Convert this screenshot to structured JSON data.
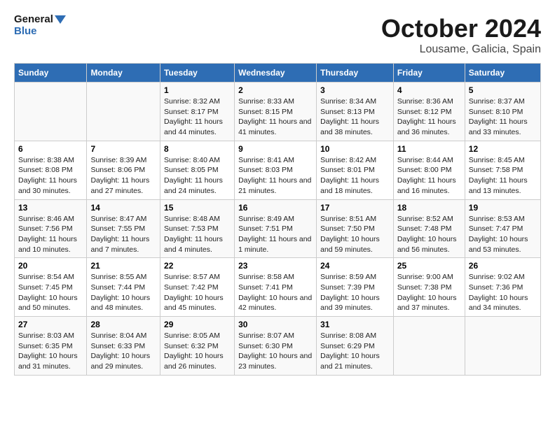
{
  "header": {
    "logo_general": "General",
    "logo_blue": "Blue",
    "title": "October 2024",
    "subtitle": "Lousame, Galicia, Spain"
  },
  "columns": [
    "Sunday",
    "Monday",
    "Tuesday",
    "Wednesday",
    "Thursday",
    "Friday",
    "Saturday"
  ],
  "weeks": [
    [
      {
        "day": "",
        "sunrise": "",
        "sunset": "",
        "daylight": ""
      },
      {
        "day": "",
        "sunrise": "",
        "sunset": "",
        "daylight": ""
      },
      {
        "day": "1",
        "sunrise": "Sunrise: 8:32 AM",
        "sunset": "Sunset: 8:17 PM",
        "daylight": "Daylight: 11 hours and 44 minutes."
      },
      {
        "day": "2",
        "sunrise": "Sunrise: 8:33 AM",
        "sunset": "Sunset: 8:15 PM",
        "daylight": "Daylight: 11 hours and 41 minutes."
      },
      {
        "day": "3",
        "sunrise": "Sunrise: 8:34 AM",
        "sunset": "Sunset: 8:13 PM",
        "daylight": "Daylight: 11 hours and 38 minutes."
      },
      {
        "day": "4",
        "sunrise": "Sunrise: 8:36 AM",
        "sunset": "Sunset: 8:12 PM",
        "daylight": "Daylight: 11 hours and 36 minutes."
      },
      {
        "day": "5",
        "sunrise": "Sunrise: 8:37 AM",
        "sunset": "Sunset: 8:10 PM",
        "daylight": "Daylight: 11 hours and 33 minutes."
      }
    ],
    [
      {
        "day": "6",
        "sunrise": "Sunrise: 8:38 AM",
        "sunset": "Sunset: 8:08 PM",
        "daylight": "Daylight: 11 hours and 30 minutes."
      },
      {
        "day": "7",
        "sunrise": "Sunrise: 8:39 AM",
        "sunset": "Sunset: 8:06 PM",
        "daylight": "Daylight: 11 hours and 27 minutes."
      },
      {
        "day": "8",
        "sunrise": "Sunrise: 8:40 AM",
        "sunset": "Sunset: 8:05 PM",
        "daylight": "Daylight: 11 hours and 24 minutes."
      },
      {
        "day": "9",
        "sunrise": "Sunrise: 8:41 AM",
        "sunset": "Sunset: 8:03 PM",
        "daylight": "Daylight: 11 hours and 21 minutes."
      },
      {
        "day": "10",
        "sunrise": "Sunrise: 8:42 AM",
        "sunset": "Sunset: 8:01 PM",
        "daylight": "Daylight: 11 hours and 18 minutes."
      },
      {
        "day": "11",
        "sunrise": "Sunrise: 8:44 AM",
        "sunset": "Sunset: 8:00 PM",
        "daylight": "Daylight: 11 hours and 16 minutes."
      },
      {
        "day": "12",
        "sunrise": "Sunrise: 8:45 AM",
        "sunset": "Sunset: 7:58 PM",
        "daylight": "Daylight: 11 hours and 13 minutes."
      }
    ],
    [
      {
        "day": "13",
        "sunrise": "Sunrise: 8:46 AM",
        "sunset": "Sunset: 7:56 PM",
        "daylight": "Daylight: 11 hours and 10 minutes."
      },
      {
        "day": "14",
        "sunrise": "Sunrise: 8:47 AM",
        "sunset": "Sunset: 7:55 PM",
        "daylight": "Daylight: 11 hours and 7 minutes."
      },
      {
        "day": "15",
        "sunrise": "Sunrise: 8:48 AM",
        "sunset": "Sunset: 7:53 PM",
        "daylight": "Daylight: 11 hours and 4 minutes."
      },
      {
        "day": "16",
        "sunrise": "Sunrise: 8:49 AM",
        "sunset": "Sunset: 7:51 PM",
        "daylight": "Daylight: 11 hours and 1 minute."
      },
      {
        "day": "17",
        "sunrise": "Sunrise: 8:51 AM",
        "sunset": "Sunset: 7:50 PM",
        "daylight": "Daylight: 10 hours and 59 minutes."
      },
      {
        "day": "18",
        "sunrise": "Sunrise: 8:52 AM",
        "sunset": "Sunset: 7:48 PM",
        "daylight": "Daylight: 10 hours and 56 minutes."
      },
      {
        "day": "19",
        "sunrise": "Sunrise: 8:53 AM",
        "sunset": "Sunset: 7:47 PM",
        "daylight": "Daylight: 10 hours and 53 minutes."
      }
    ],
    [
      {
        "day": "20",
        "sunrise": "Sunrise: 8:54 AM",
        "sunset": "Sunset: 7:45 PM",
        "daylight": "Daylight: 10 hours and 50 minutes."
      },
      {
        "day": "21",
        "sunrise": "Sunrise: 8:55 AM",
        "sunset": "Sunset: 7:44 PM",
        "daylight": "Daylight: 10 hours and 48 minutes."
      },
      {
        "day": "22",
        "sunrise": "Sunrise: 8:57 AM",
        "sunset": "Sunset: 7:42 PM",
        "daylight": "Daylight: 10 hours and 45 minutes."
      },
      {
        "day": "23",
        "sunrise": "Sunrise: 8:58 AM",
        "sunset": "Sunset: 7:41 PM",
        "daylight": "Daylight: 10 hours and 42 minutes."
      },
      {
        "day": "24",
        "sunrise": "Sunrise: 8:59 AM",
        "sunset": "Sunset: 7:39 PM",
        "daylight": "Daylight: 10 hours and 39 minutes."
      },
      {
        "day": "25",
        "sunrise": "Sunrise: 9:00 AM",
        "sunset": "Sunset: 7:38 PM",
        "daylight": "Daylight: 10 hours and 37 minutes."
      },
      {
        "day": "26",
        "sunrise": "Sunrise: 9:02 AM",
        "sunset": "Sunset: 7:36 PM",
        "daylight": "Daylight: 10 hours and 34 minutes."
      }
    ],
    [
      {
        "day": "27",
        "sunrise": "Sunrise: 8:03 AM",
        "sunset": "Sunset: 6:35 PM",
        "daylight": "Daylight: 10 hours and 31 minutes."
      },
      {
        "day": "28",
        "sunrise": "Sunrise: 8:04 AM",
        "sunset": "Sunset: 6:33 PM",
        "daylight": "Daylight: 10 hours and 29 minutes."
      },
      {
        "day": "29",
        "sunrise": "Sunrise: 8:05 AM",
        "sunset": "Sunset: 6:32 PM",
        "daylight": "Daylight: 10 hours and 26 minutes."
      },
      {
        "day": "30",
        "sunrise": "Sunrise: 8:07 AM",
        "sunset": "Sunset: 6:30 PM",
        "daylight": "Daylight: 10 hours and 23 minutes."
      },
      {
        "day": "31",
        "sunrise": "Sunrise: 8:08 AM",
        "sunset": "Sunset: 6:29 PM",
        "daylight": "Daylight: 10 hours and 21 minutes."
      },
      {
        "day": "",
        "sunrise": "",
        "sunset": "",
        "daylight": ""
      },
      {
        "day": "",
        "sunrise": "",
        "sunset": "",
        "daylight": ""
      }
    ]
  ]
}
